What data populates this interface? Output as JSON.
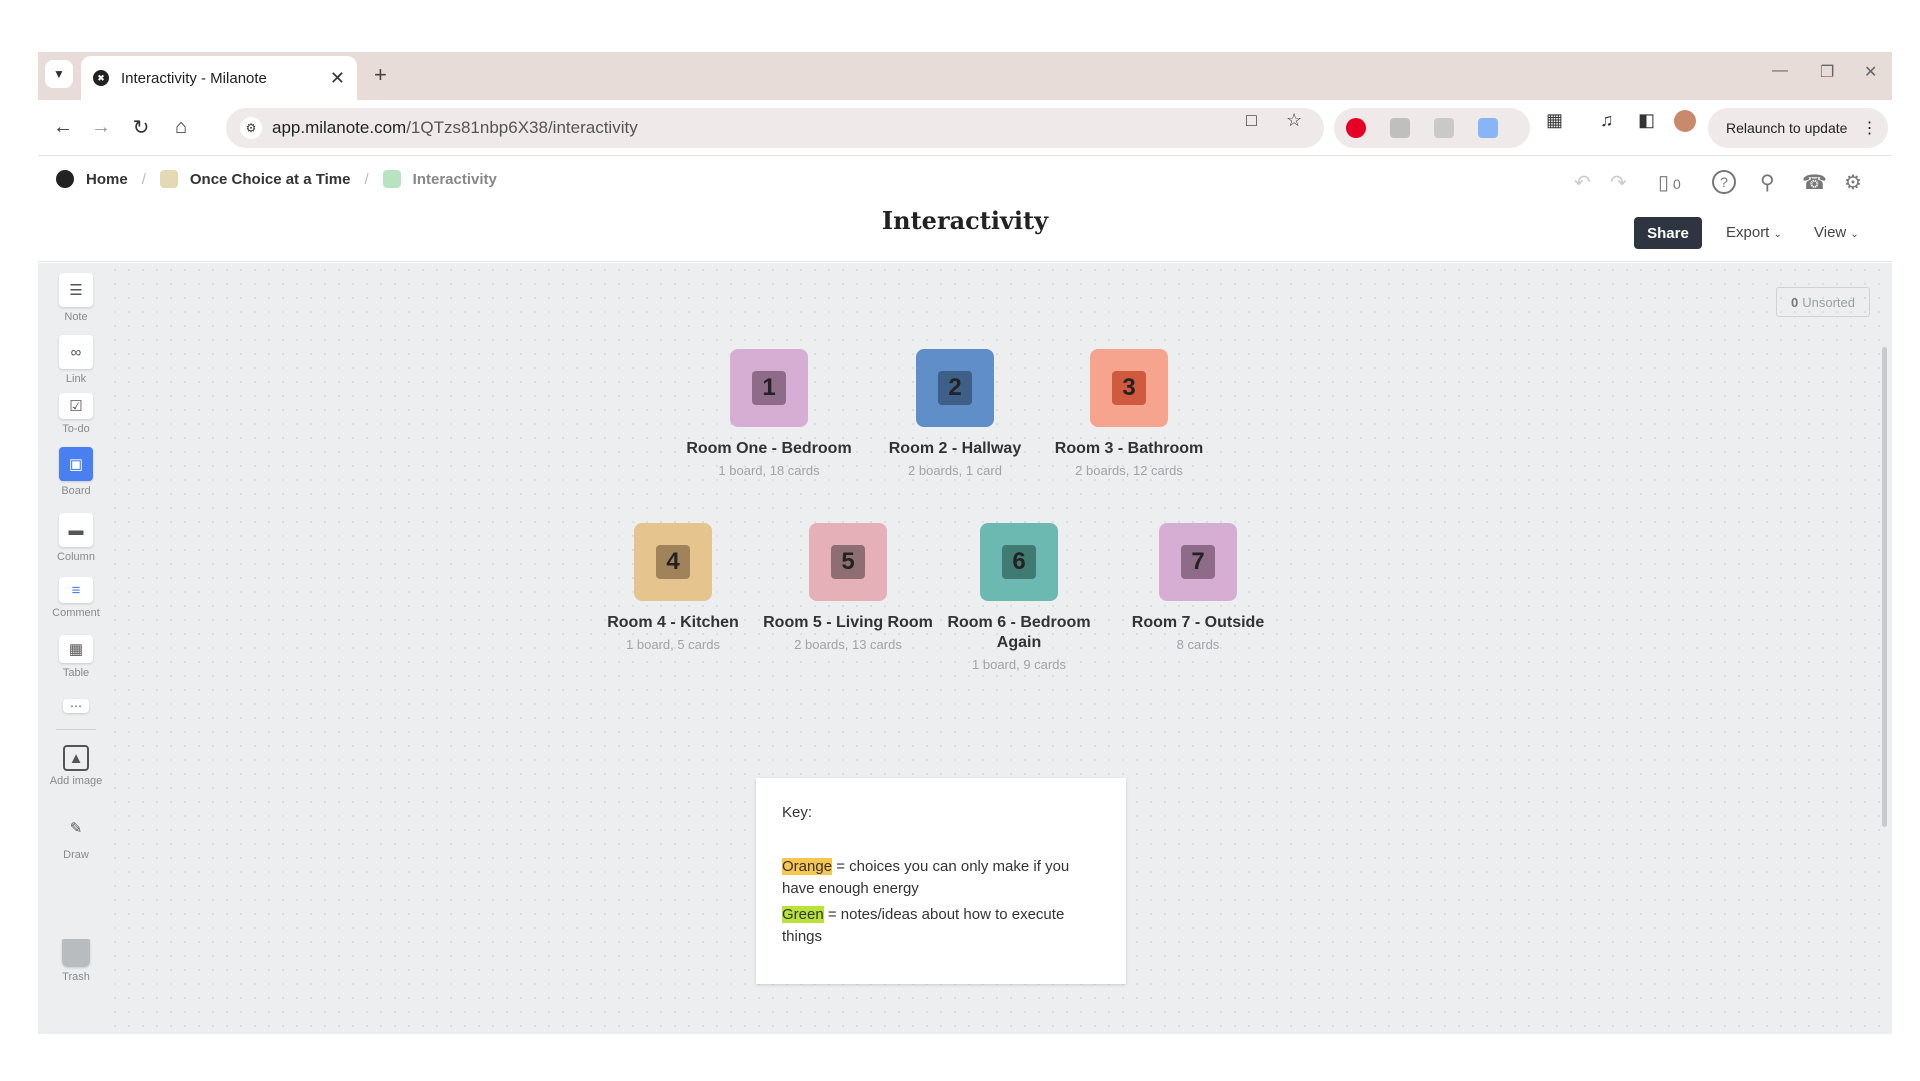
{
  "browser": {
    "tab_title": "Interactivity - Milanote",
    "url_host": "app.milanote.com",
    "url_path": "/1QTzs81nbp6X38/interactivity",
    "relaunch_label": "Relaunch to update"
  },
  "breadcrumb": {
    "home": "Home",
    "parent": "Once Choice at a Time",
    "current": "Interactivity"
  },
  "header": {
    "title": "Interactivity",
    "share_label": "Share",
    "export_label": "Export",
    "view_label": "View",
    "device_count": "0"
  },
  "tools": [
    {
      "label": "Note",
      "icon": "note-icon"
    },
    {
      "label": "Link",
      "icon": "link-icon"
    },
    {
      "label": "To-do",
      "icon": "todo-icon"
    },
    {
      "label": "Board",
      "icon": "board-icon"
    },
    {
      "label": "Column",
      "icon": "column-icon"
    },
    {
      "label": "Comment",
      "icon": "comment-icon"
    },
    {
      "label": "Table",
      "icon": "table-icon"
    },
    {
      "label": "Add image",
      "icon": "image-icon"
    },
    {
      "label": "Draw",
      "icon": "draw-icon"
    },
    {
      "label": "Trash",
      "icon": "trash-icon"
    }
  ],
  "unsorted": {
    "count": "0",
    "label": "Unsorted"
  },
  "boards": [
    {
      "number": "1",
      "name": "Room One - Bedroom",
      "meta": "1 board, 18 cards",
      "color": "#d6aed3",
      "num_color": "#8e6b89"
    },
    {
      "number": "2",
      "name": "Room 2 - Hallway",
      "meta": "2 boards, 1 card",
      "color": "#5f8ec8",
      "num_color": "#3e5f87"
    },
    {
      "number": "3",
      "name": "Room 3 - Bathroom",
      "meta": "2 boards, 12 cards",
      "color": "#f7a48f",
      "num_color": "#d05a3e"
    },
    {
      "number": "4",
      "name": "Room 4 - Kitchen",
      "meta": "1 board, 5 cards",
      "color": "#e6c48e",
      "num_color": "#a0835a"
    },
    {
      "number": "5",
      "name": "Room 5 - Living Room",
      "meta": "2 boards, 13 cards",
      "color": "#e5b0b8",
      "num_color": "#8f6e73"
    },
    {
      "number": "6",
      "name": "Room 6 - Bedroom Again",
      "meta": "1 board, 9 cards",
      "color": "#6bb9b0",
      "num_color": "#3f7a73"
    },
    {
      "number": "7",
      "name": "Room 7 - Outside",
      "meta": "8 cards",
      "color": "#d6aed3",
      "num_color": "#8e6b89"
    }
  ],
  "key_note": {
    "heading": "Key:",
    "orange_word": "Orange",
    "orange_text": " = choices you can only make if you have enough energy",
    "green_word": "Green",
    "green_text": " = notes/ideas about how to execute things"
  }
}
